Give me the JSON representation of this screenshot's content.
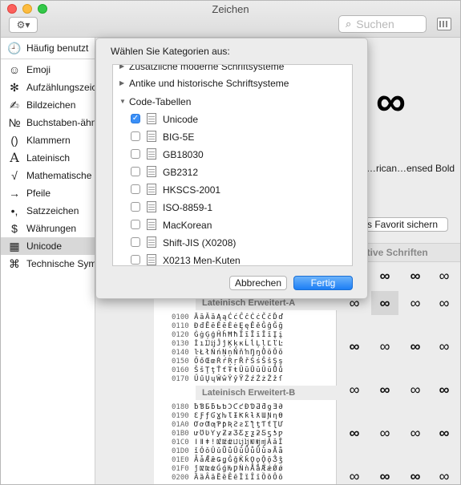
{
  "window": {
    "title": "Zeichen"
  },
  "toolbar": {
    "search_placeholder": "Suchen",
    "gear_glyph": "⚙︎▾"
  },
  "sidebar": {
    "items": [
      {
        "label": "Häufig benutzt",
        "glyph": "🕘"
      },
      {
        "label": "Emoji",
        "glyph": "☺"
      },
      {
        "label": "Aufzählungszeichen/Sterne",
        "glyph": "✻"
      },
      {
        "label": "Bildzeichen",
        "glyph": "✍"
      },
      {
        "label": "Buchstaben-ähnliche Symbole",
        "glyph": "№"
      },
      {
        "label": "Klammern",
        "glyph": "()"
      },
      {
        "label": "Lateinisch",
        "glyph": "A"
      },
      {
        "label": "Mathematische Symbole",
        "glyph": "√"
      },
      {
        "label": "Pfeile",
        "glyph": "→"
      },
      {
        "label": "Satzzeichen",
        "glyph": "•,"
      },
      {
        "label": "Währungen",
        "glyph": "$"
      },
      {
        "label": "Unicode",
        "glyph": "▦"
      },
      {
        "label": "Technische Symbole",
        "glyph": "⌘"
      }
    ],
    "selected_index": 11
  },
  "preview": {
    "glyph": "∞",
    "name": "…rican…ensed Bold",
    "favorite_label": "s Favorit sichern"
  },
  "alternatives": {
    "header": "ative Schriften",
    "glyph": "∞"
  },
  "unicode_table": {
    "block1": {
      "title": "Lateinisch Erweitert-A",
      "rows": [
        {
          "code": "0100",
          "chars": "ĀāĂăĄąĆćĈĉĊċČčĎď"
        },
        {
          "code": "0110",
          "chars": "ĐđĒēĔĕĖėĘęĚěĜĝĞğ"
        },
        {
          "code": "0120",
          "chars": "ĠġĢģĤĥĦħĨĩĪīĬĭĮį"
        },
        {
          "code": "0130",
          "chars": "İıĲĳĴĵĶķĸĹĺĻļĽľĿ"
        },
        {
          "code": "0140",
          "chars": "ŀŁłŃńŅņŇňŉŊŋŌōŎŏ"
        },
        {
          "code": "0150",
          "chars": "ŐőŒœŔŕŖŗŘřŚśŜŝŞş"
        },
        {
          "code": "0160",
          "chars": "ŠšŢţŤťŦŧŨũŪūŬŭŮů"
        },
        {
          "code": "0170",
          "chars": "ŰűŲųŴŵŶŷŸŹźŻżŽžſ"
        }
      ]
    },
    "block2": {
      "title": "Lateinisch Erweitert-B",
      "rows": [
        {
          "code": "0180",
          "chars": "ƀƁƂƃƄƅƆƇƈƉƊƋƌƍƎƏ"
        },
        {
          "code": "0190",
          "chars": "ƐƑƒƓƔƕƖƗƘƙƚƛƜƝƞƟ"
        },
        {
          "code": "01A0",
          "chars": "ƠơƢƣƤƥƦƧƨƩƪƫƬƭƮƯ"
        },
        {
          "code": "01B0",
          "chars": "ưƱƲƳƴƵƶƷƸƹƺƻƼƽƾƿ"
        },
        {
          "code": "01C0",
          "chars": "ǀǁǂǃǄǅǆǇǈǉǊǋǌǍǎǏ"
        },
        {
          "code": "01D0",
          "chars": "ǐǑǒǓǔǕǖǗǘǙǚǛǜǝǞǟ"
        },
        {
          "code": "01E0",
          "chars": "ǠǡǢǣǤǥǦǧǨǩǪǫǬǭǮǯ"
        },
        {
          "code": "01F0",
          "chars": "ǰǱǲǳǴǵǶǷǸǹǺǻǼǽǾǿ"
        },
        {
          "code": "0200",
          "chars": "ȀȁȂȃȄȅȆȇȈȉȊȋȌȍȎȏ"
        }
      ]
    }
  },
  "popover": {
    "title": "Wählen Sie Kategorien aus:",
    "groups": [
      {
        "label": "Zusätzliche moderne Schriftsysteme",
        "expanded": false
      },
      {
        "label": "Antike und historische Schriftsysteme",
        "expanded": false
      },
      {
        "label": "Code-Tabellen",
        "expanded": true
      }
    ],
    "items": [
      {
        "label": "Unicode",
        "checked": true
      },
      {
        "label": "BIG-5E",
        "checked": false
      },
      {
        "label": "GB18030",
        "checked": false
      },
      {
        "label": "GB2312",
        "checked": false
      },
      {
        "label": "HKSCS-2001",
        "checked": false
      },
      {
        "label": "ISO-8859-1",
        "checked": false
      },
      {
        "label": "MacKorean",
        "checked": false
      },
      {
        "label": "Shift-JIS (X0208)",
        "checked": false
      },
      {
        "label": "X0213 Men-Kuten",
        "checked": false
      }
    ],
    "cancel_label": "Abbrechen",
    "done_label": "Fertig"
  }
}
